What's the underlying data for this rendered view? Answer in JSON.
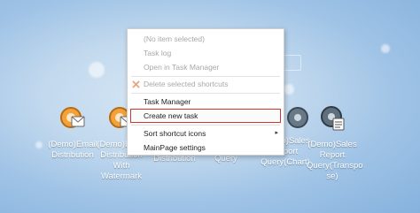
{
  "desktop": {
    "icons": [
      {
        "label": "(Demo)Email\nDistribution",
        "icon": "gear-mail-icon"
      },
      {
        "label": "(Demo)Email\nDistribution\nWith\nWatermark",
        "icon": "gear-mail-icon"
      },
      {
        "label": "Distribution",
        "icon": "gear-mail-icon"
      },
      {
        "label": "Query",
        "icon": "gear-report-icon"
      },
      {
        "label": "(Demo)Sales\nReport\nQuery(Chart)",
        "icon": "gear-report-icon"
      },
      {
        "label": "(Demo)Sales\nReport\nQuery(Transpo\nse)",
        "icon": "gear-report-icon"
      }
    ]
  },
  "context_menu": {
    "items": [
      {
        "label": "(No item selected)",
        "disabled": true
      },
      {
        "label": "Task log",
        "disabled": true
      },
      {
        "label": "Open in Task Manager",
        "disabled": true
      },
      {
        "label": "Delete selected shortcuts",
        "disabled": true,
        "icon": "x-icon"
      },
      {
        "label": "Task Manager",
        "disabled": false
      },
      {
        "label": "Create new task",
        "disabled": false,
        "highlighted": true
      },
      {
        "label": "Sort shortcut icons",
        "disabled": false,
        "submenu": true,
        "arrow": "▸"
      },
      {
        "label": "MainPage settings",
        "disabled": false
      }
    ]
  },
  "colors": {
    "highlight_border": "#d9332b",
    "desktop_bg": "#9fc3e6"
  }
}
